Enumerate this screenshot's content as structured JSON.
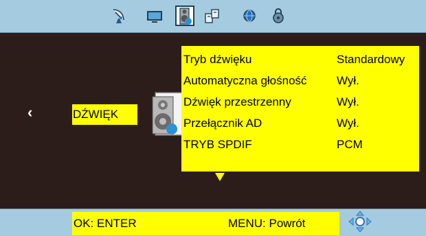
{
  "tabs": [
    {
      "icon": "satellite-icon"
    },
    {
      "icon": "screen-icon"
    },
    {
      "icon": "sound-icon",
      "selected": true
    },
    {
      "icon": "setup-icon"
    },
    {
      "icon": "globe-icon"
    },
    {
      "icon": "lock-icon"
    }
  ],
  "section": {
    "label": "DŹWIĘK",
    "prev_icon": "chevron-left-icon",
    "prev_glyph": "‹",
    "icon": "speaker-icon"
  },
  "menu": {
    "items": [
      {
        "label": "Tryb dźwięku",
        "value": "Standardowy"
      },
      {
        "label": "Automatyczna głośność",
        "value": "Wył."
      },
      {
        "label": "Dźwięk przestrzenny",
        "value": "Wył."
      },
      {
        "label": "Przełącznik AD",
        "value": "Wył."
      },
      {
        "label": "TRYB SPDIF",
        "value": "PCM"
      }
    ],
    "more_icon": "scroll-down-icon"
  },
  "footer": {
    "ok_hint": "OK: ENTER",
    "menu_hint": "MENU: Powrót",
    "nav_icon": "navigation-pad-icon"
  },
  "colors": {
    "highlight": "#ffff00",
    "background": "#2c1d1b",
    "bar": "#a5cbe0"
  }
}
